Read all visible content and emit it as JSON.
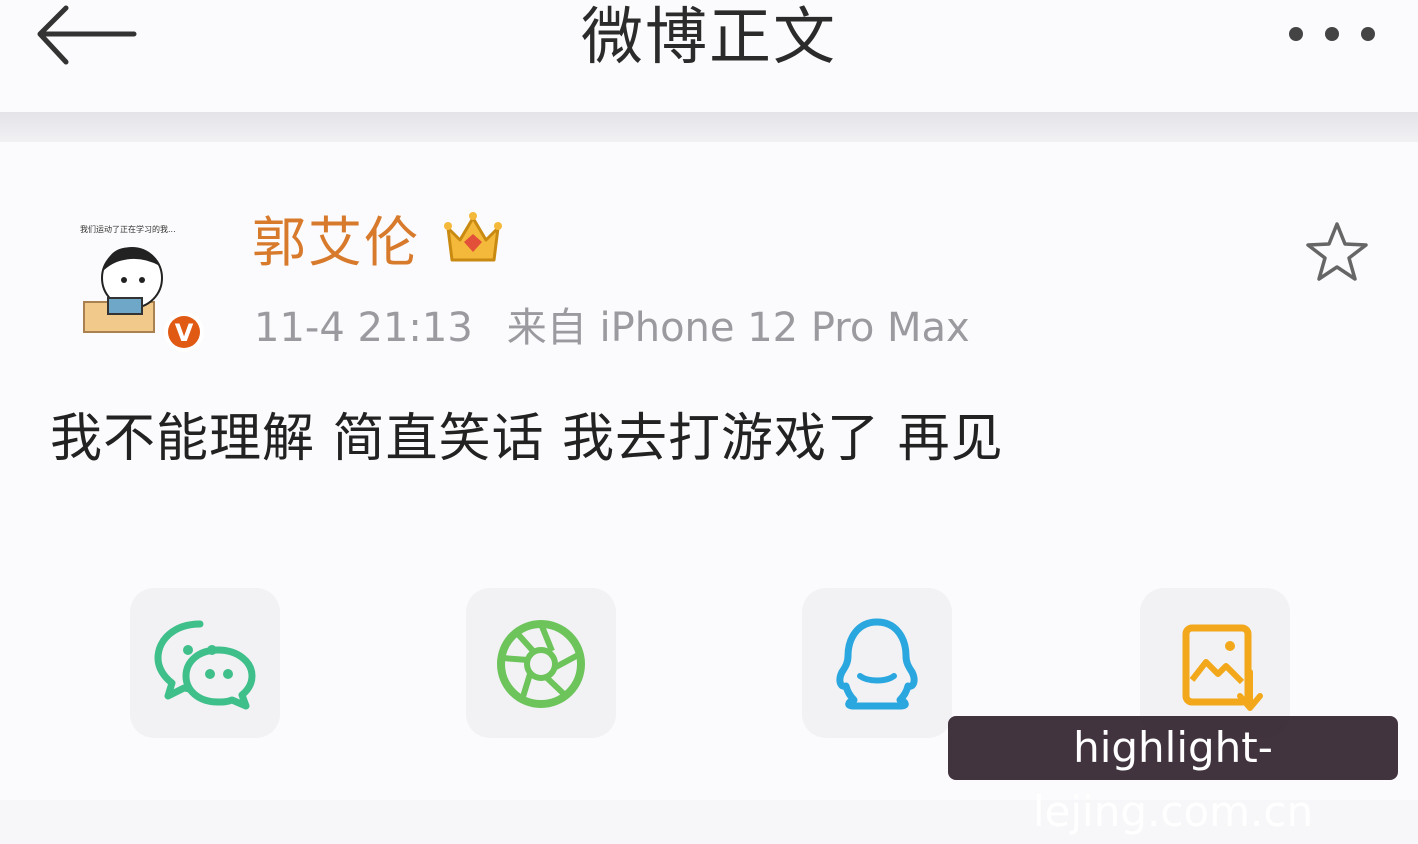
{
  "header": {
    "title": "微博正文",
    "back_icon": "back-arrow-icon",
    "more_icon": "more-dots-icon"
  },
  "post": {
    "username": "郭艾伦",
    "crown_icon": "crown-icon",
    "verified_badge": "V",
    "avatar_caption": "我们运动了正在学习的我...",
    "time": "11-4 21:13",
    "source": "来自 iPhone 12 Pro Max",
    "text": "我不能理解 简直笑话 我去打游戏了 再见",
    "favorite_icon": "star-icon"
  },
  "share": [
    {
      "name": "wechat",
      "icon": "wechat-icon"
    },
    {
      "name": "moments",
      "icon": "moments-icon"
    },
    {
      "name": "qq",
      "icon": "qq-icon"
    },
    {
      "name": "save-image",
      "icon": "save-image-icon"
    }
  ],
  "watermark": "highlight-lejing.com.cn",
  "colors": {
    "username": "#d87a2c",
    "meta": "#9a9a9f",
    "wechat": "#3fbf8a",
    "moments": "#6cc45a",
    "qq": "#2aa7df",
    "save": "#f2a81a"
  }
}
